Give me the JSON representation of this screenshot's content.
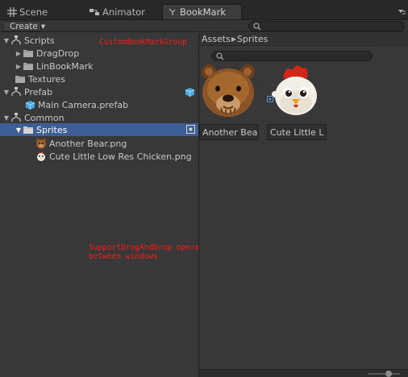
{
  "tabs": [
    {
      "label": "Scene",
      "icon": "grid-icon"
    },
    {
      "label": "Animator",
      "icon": "animator-icon"
    },
    {
      "label": "BookMark",
      "icon": "bookmark-icon",
      "active": true
    }
  ],
  "toolbar": {
    "create_label": "Create",
    "caret": "▾",
    "search_placeholder": ""
  },
  "tree": [
    {
      "label": "Scripts",
      "icon": "bookmark-group-icon",
      "expanded": true
    },
    {
      "label": "DragDrop",
      "icon": "folder-icon"
    },
    {
      "label": "LinBookMark",
      "icon": "folder-icon"
    },
    {
      "label": "Textures",
      "icon": "folder-icon"
    },
    {
      "label": "Prefab",
      "icon": "bookmark-group-icon",
      "expanded": true
    },
    {
      "label": "Main Camera.prefab",
      "icon": "prefab-cube-icon"
    },
    {
      "label": "Common",
      "icon": "bookmark-group-icon",
      "expanded": true
    },
    {
      "label": "Sprites",
      "icon": "folder-icon",
      "selected": true
    },
    {
      "label": "Another Bear.png",
      "icon": "bear-sprite-icon"
    },
    {
      "label": "Cute Little Low Res Chicken.png",
      "icon": "chicken-sprite-icon"
    }
  ],
  "annotations": {
    "group": "CustomBookMarkGroup",
    "dragdrop": "SupportDragAndDrop operation between book Mark Nodes Event between windows"
  },
  "browser": {
    "breadcrumb": [
      "Assets",
      "Sprites"
    ],
    "assets": [
      {
        "name": "Another Bear",
        "icon": "bear-sprite-thumbnail"
      },
      {
        "name": "Cute Little L",
        "icon": "chicken-sprite-thumbnail"
      }
    ]
  },
  "colors": {
    "selection": "#3e5f96",
    "annotation": "#ff1a1a",
    "background": "#383838"
  }
}
